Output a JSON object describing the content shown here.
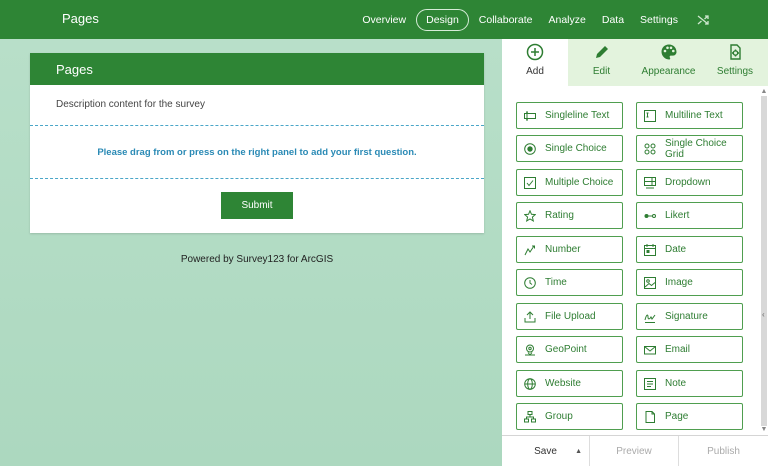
{
  "app": {
    "title": "Pages"
  },
  "nav": {
    "items": [
      {
        "label": "Overview",
        "active": false
      },
      {
        "label": "Design",
        "active": true
      },
      {
        "label": "Collaborate",
        "active": false
      },
      {
        "label": "Analyze",
        "active": false
      },
      {
        "label": "Data",
        "active": false
      },
      {
        "label": "Settings",
        "active": false
      }
    ],
    "extra_icon": "shuffle-icon"
  },
  "form": {
    "title": "Pages",
    "description": "Description content for the survey",
    "drop_hint": "Please drag from or press on the right panel to add your first question.",
    "submit_label": "Submit"
  },
  "powered_by": "Powered by Survey123 for ArcGIS",
  "panel": {
    "tabs": [
      {
        "label": "Add",
        "icon": "plus-circle-icon",
        "active": true
      },
      {
        "label": "Edit",
        "icon": "pencil-icon",
        "active": false
      },
      {
        "label": "Appearance",
        "icon": "palette-icon",
        "active": false
      },
      {
        "label": "Settings",
        "icon": "gear-doc-icon",
        "active": false
      }
    ],
    "questions": [
      {
        "label": "Singleline Text",
        "icon": "singleline-icon"
      },
      {
        "label": "Multiline Text",
        "icon": "multiline-icon"
      },
      {
        "label": "Single Choice",
        "icon": "radio-icon"
      },
      {
        "label": "Single Choice Grid",
        "icon": "grid-choice-icon"
      },
      {
        "label": "Multiple Choice",
        "icon": "checkbox-icon"
      },
      {
        "label": "Dropdown",
        "icon": "dropdown-icon"
      },
      {
        "label": "Rating",
        "icon": "star-icon"
      },
      {
        "label": "Likert",
        "icon": "likert-icon"
      },
      {
        "label": "Number",
        "icon": "number-icon"
      },
      {
        "label": "Date",
        "icon": "calendar-icon"
      },
      {
        "label": "Time",
        "icon": "clock-icon"
      },
      {
        "label": "Image",
        "icon": "image-icon"
      },
      {
        "label": "File Upload",
        "icon": "upload-icon"
      },
      {
        "label": "Signature",
        "icon": "signature-icon"
      },
      {
        "label": "GeoPoint",
        "icon": "geopoint-icon"
      },
      {
        "label": "Email",
        "icon": "email-icon"
      },
      {
        "label": "Website",
        "icon": "globe-icon"
      },
      {
        "label": "Note",
        "icon": "note-icon"
      },
      {
        "label": "Group",
        "icon": "group-icon"
      },
      {
        "label": "Page",
        "icon": "page-icon"
      }
    ],
    "footer": {
      "save": "Save",
      "preview": "Preview",
      "publish": "Publish"
    }
  },
  "colors": {
    "brand": "#2e8535",
    "link": "#2a8ab5"
  }
}
